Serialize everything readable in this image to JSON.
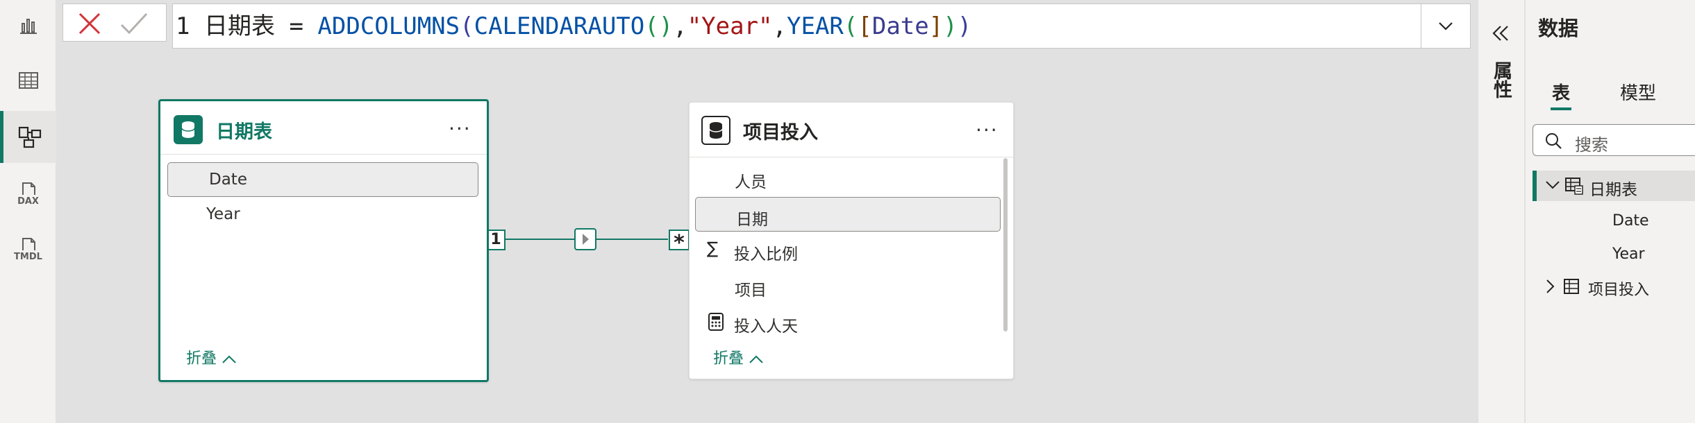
{
  "left_rail": {
    "items": [
      {
        "name": "report-view-icon"
      },
      {
        "name": "table-view-icon"
      },
      {
        "name": "model-view-icon",
        "active": true
      },
      {
        "name": "dax-query-view-icon",
        "label": "DAX"
      },
      {
        "name": "tmdl-view-icon",
        "label": "TMDL"
      }
    ]
  },
  "formula_bar": {
    "line_number": "1",
    "table_name": "日期表",
    "equals": "=",
    "fn1": "ADDCOLUMNS",
    "fn2": "CALENDARAUTO",
    "string_arg": "\"Year\"",
    "fn3": "YEAR",
    "column_ref": "Date",
    "cancel_icon": "close-icon",
    "commit_icon": "check-icon"
  },
  "tables": {
    "date_table": {
      "title": "日期表",
      "fields": [
        "Date",
        "Year"
      ],
      "collapse_label": "折叠"
    },
    "project_table": {
      "title": "项目投入",
      "fields": [
        "人员",
        "日期",
        "投入比例",
        "项目",
        "投入人天"
      ],
      "collapse_label": "折叠"
    }
  },
  "relationship": {
    "from_cardinality": "1",
    "to_cardinality": "*"
  },
  "properties_pane": {
    "title": "属性"
  },
  "data_pane": {
    "title": "数据",
    "tabs": [
      "表",
      "模型"
    ],
    "active_tab": "表",
    "search_placeholder": "搜索",
    "tree": [
      {
        "label": "日期表",
        "expanded": true,
        "children": [
          "Date",
          "Year"
        ]
      },
      {
        "label": "项目投入",
        "expanded": false
      }
    ]
  },
  "colors": {
    "accent": "#117865",
    "canvas": "#e1e1e1",
    "string": "#a31515",
    "function": "#0451a5"
  }
}
